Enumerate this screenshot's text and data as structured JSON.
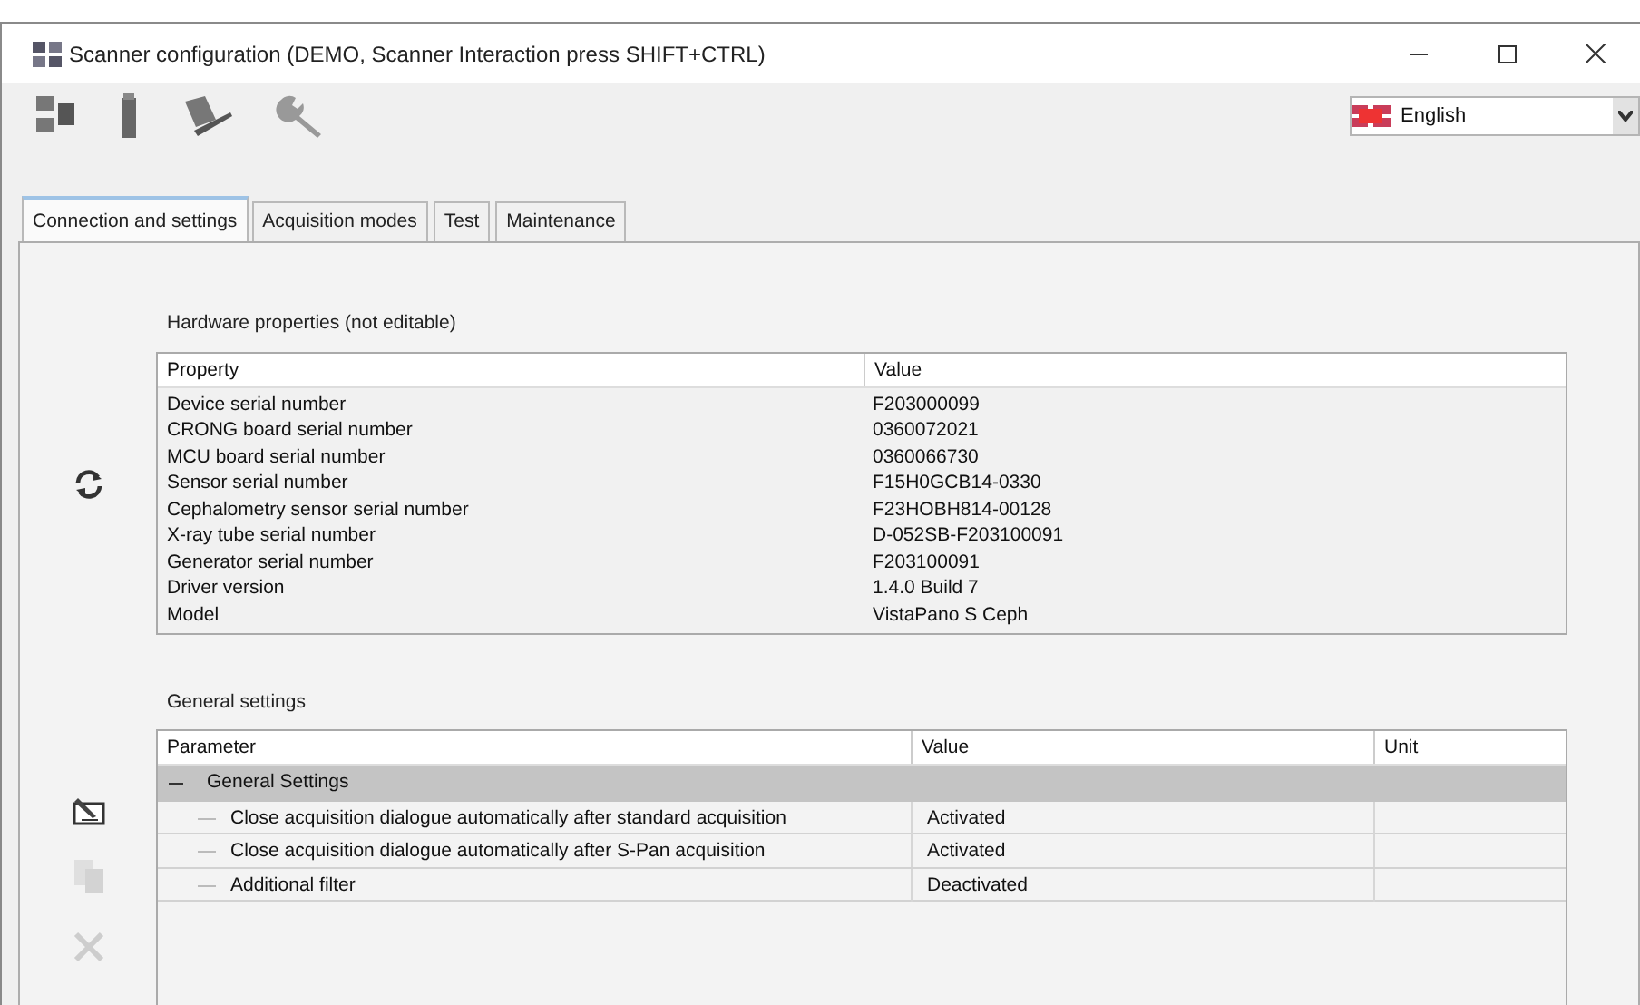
{
  "window": {
    "title": "Scanner configuration (DEMO, Scanner Interaction press SHIFT+CTRL)"
  },
  "language": {
    "value": "English"
  },
  "tabs": [
    {
      "label": "Connection and settings",
      "selected": true
    },
    {
      "label": "Acquisition modes",
      "selected": false
    },
    {
      "label": "Test",
      "selected": false
    },
    {
      "label": "Maintenance",
      "selected": false
    }
  ],
  "side_actions": [
    {
      "kind": "edit",
      "disabled": false
    },
    {
      "kind": "copy",
      "disabled": true
    },
    {
      "kind": "delete",
      "disabled": true
    }
  ],
  "hardware": {
    "title": "Hardware properties (not editable)",
    "columns": [
      "Property",
      "Value"
    ],
    "rows": [
      [
        "Device serial number",
        "F203000099"
      ],
      [
        "CRONG board serial number",
        "0360072021"
      ],
      [
        "MCU board serial number",
        "0360066730"
      ],
      [
        "Sensor serial number",
        "F15H0GCB14-0330"
      ],
      [
        "Cephalometry sensor serial number",
        "F23HOBH814-00128"
      ],
      [
        "X-ray tube serial number",
        "D-052SB-F203100091"
      ],
      [
        "Generator serial number",
        "F203100091"
      ],
      [
        "Driver version",
        "1.4.0 Build 7"
      ],
      [
        "Model",
        "VistaPano S Ceph"
      ]
    ]
  },
  "general": {
    "title": "General settings",
    "columns": [
      "Parameter",
      "Value",
      "Unit"
    ],
    "groups": [
      {
        "label": "General Settings",
        "expanded": true,
        "rows": [
          {
            "parameter": "Close acquisition dialogue automatically after standard acquisition",
            "value": "Activated"
          },
          {
            "parameter": "Close acquisition dialogue automatically after S-Pan acquisition",
            "value": "Activated"
          },
          {
            "parameter": "Additional filter",
            "value": "Deactivated"
          }
        ]
      }
    ]
  }
}
